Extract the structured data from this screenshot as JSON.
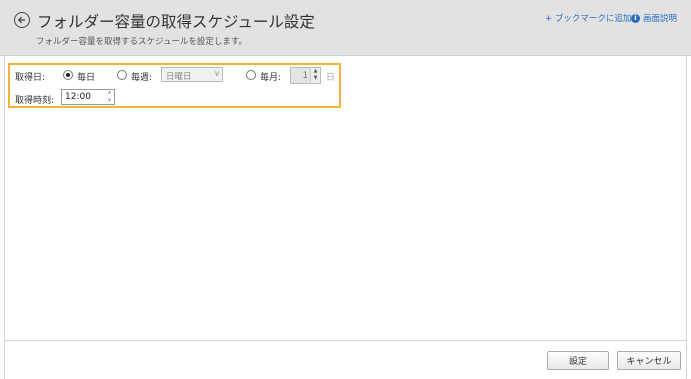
{
  "header": {
    "title": "フォルダー容量の取得スケジュール設定",
    "subtitle": "フォルダー容量を取得するスケジュールを設定します。",
    "bookmark_link": "+ ブックマークに追加",
    "help_link": "画面説明",
    "help_icon_char": "i"
  },
  "form": {
    "day_label": "取得日:",
    "daily_label": "毎日",
    "weekly_label": "毎週:",
    "weekly_select_value": "日曜日",
    "monthly_label": "毎月:",
    "monthly_value": "1",
    "day_unit": "日",
    "selected_frequency": "daily",
    "time_label": "取得時刻:",
    "time_value": "12:00"
  },
  "footer": {
    "set_button": "設定",
    "cancel_button": "キャンセル"
  },
  "colors": {
    "highlight_border": "#f0b43a",
    "link": "#2a6cc0",
    "header_bg": "#e2e2e2"
  }
}
